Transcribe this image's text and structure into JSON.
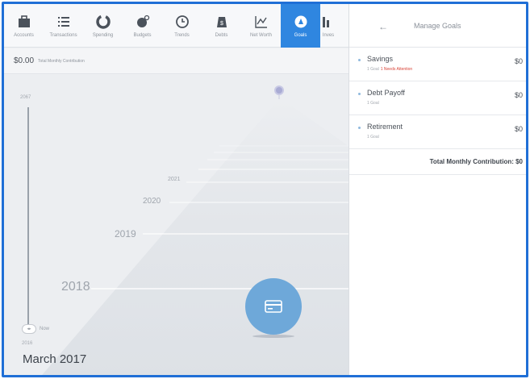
{
  "nav": {
    "items": [
      {
        "label": "Accounts",
        "icon": "briefcase-icon"
      },
      {
        "label": "Transactions",
        "icon": "list-icon"
      },
      {
        "label": "Spending",
        "icon": "pie-chart-icon"
      },
      {
        "label": "Budgets",
        "icon": "budget-icon"
      },
      {
        "label": "Trends",
        "icon": "clock-icon"
      },
      {
        "label": "Debts",
        "icon": "debt-icon"
      },
      {
        "label": "Net Worth",
        "icon": "line-chart-icon"
      },
      {
        "label": "Goals",
        "icon": "goal-icon"
      },
      {
        "label": "Inves",
        "icon": "investments-icon"
      }
    ],
    "active": "Goals",
    "active_color": "#2f86e0"
  },
  "contribution_bar": {
    "amount": "$0.00",
    "label": "Total Monthly Contribution"
  },
  "timeline": {
    "top_year": "2067",
    "bottom_year": "2016",
    "now_label": "Now",
    "handle_label": "◂▸",
    "years": {
      "y2018": "2018",
      "y2019": "2019",
      "y2020": "2020",
      "y2021": "2021"
    },
    "current_date": "March 2017"
  },
  "panel": {
    "title": "Manage Goals",
    "back_icon": "arrow-left-icon",
    "goals": [
      {
        "name": "Savings",
        "sub": "1 Goal",
        "alert": "1 Needs Attention",
        "amount": "$0"
      },
      {
        "name": "Debt Payoff",
        "sub": "1 Goal",
        "alert": "",
        "amount": "$0"
      },
      {
        "name": "Retirement",
        "sub": "1 Goal",
        "alert": "",
        "amount": "$0"
      }
    ],
    "total_label": "Total Monthly Contribution: $0"
  },
  "colors": {
    "accent": "#2f86e0",
    "action_button": "#6ea8d9",
    "alert": "#d9473b"
  }
}
